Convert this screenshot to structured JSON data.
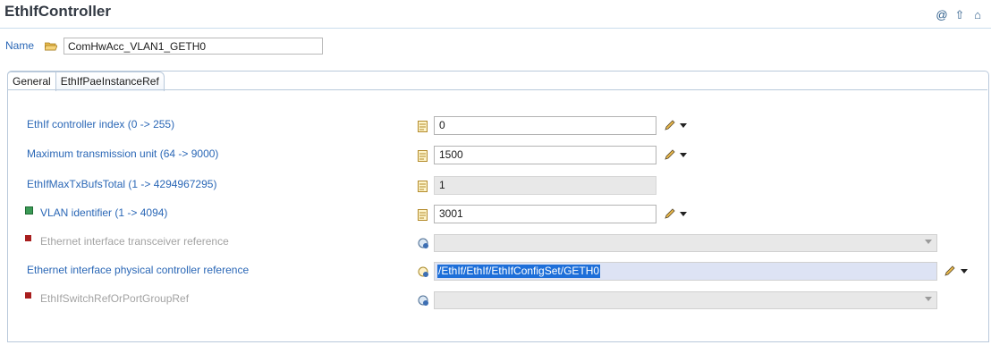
{
  "header": {
    "title": "EthIfController"
  },
  "name_field": {
    "label": "Name",
    "value": "ComHwAcc_VLAN1_GETH0"
  },
  "tabs": [
    {
      "label": "General"
    },
    {
      "label": "EthIfPaeInstanceRef"
    }
  ],
  "rows": [
    {
      "label": "EthIf controller index (0 -> 255)",
      "value": "0"
    },
    {
      "label": "Maximum transmission unit (64 -> 9000)",
      "value": "1500"
    },
    {
      "label": "EthIfMaxTxBufsTotal (1 -> 4294967295)",
      "value": "1"
    },
    {
      "label": "VLAN identifier (1 -> 4094)",
      "value": "3001"
    },
    {
      "label": "Ethernet interface transceiver reference",
      "value": ""
    },
    {
      "label": "Ethernet interface physical controller reference",
      "value": "/EthIf/EthIf/EthIfConfigSet/GETH0"
    },
    {
      "label": "EthIfSwitchRefOrPortGroupRef",
      "value": ""
    }
  ],
  "colors": {
    "label_blue": "#2a67b6",
    "disabled_gray": "#a3a3a3",
    "selection_blue": "#1e6fd9",
    "required_red": "#a81e1e",
    "status_green": "#3b9a56"
  }
}
